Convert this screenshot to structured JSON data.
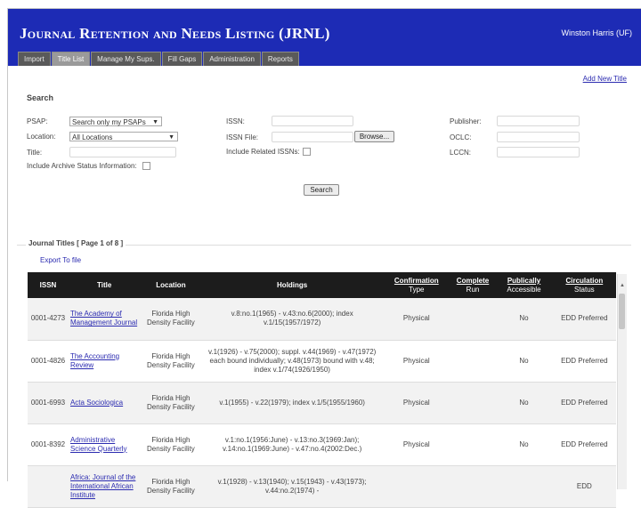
{
  "app": {
    "title": "Journal Retention and Needs Listing (JRNL)",
    "user": "Winston Harris (UF)"
  },
  "tabs": [
    {
      "label": "Import",
      "active": false
    },
    {
      "label": "Title List",
      "active": true
    },
    {
      "label": "Manage My Sups.",
      "active": false
    },
    {
      "label": "Fill Gaps",
      "active": false
    },
    {
      "label": "Administration",
      "active": false
    },
    {
      "label": "Reports",
      "active": false
    }
  ],
  "add_new_title": "Add New Title",
  "search": {
    "heading": "Search",
    "psap_label": "PSAP:",
    "psap_value": "Search only my PSAPs",
    "location_label": "Location:",
    "location_value": "All Locations",
    "title_label": "Title:",
    "archive_label": "Include Archive Status Information:",
    "issn_label": "ISSN:",
    "issn_file_label": "ISSN File:",
    "browse_label": "Browse...",
    "related_label": "Include Related ISSNs:",
    "publisher_label": "Publisher:",
    "oclc_label": "OCLC:",
    "lccn_label": "LCCN:",
    "search_button": "Search"
  },
  "results": {
    "legend": "Journal Titles [ Page 1 of 8 ]",
    "export": "Export To file",
    "columns": {
      "issn": "ISSN",
      "title": "Title",
      "location": "Location",
      "holdings": "Holdings",
      "confirmation": "Confirmation",
      "confirmation_sub": "Type",
      "complete": "Complete",
      "complete_sub": "Run",
      "publicly": "Publically",
      "publicly_sub": "Accessible",
      "circulation": "Circulation",
      "circulation_sub": "Status"
    },
    "rows": [
      {
        "issn": "0001-4273",
        "title": "The Academy of Management Journal",
        "location": "Florida High Density Facility",
        "holdings": "v.8:no.1(1965) - v.43:no.6(2000); index v.1/15(1957/1972)",
        "type": "Physical",
        "complete": "",
        "public": "No",
        "circ": "EDD Preferred"
      },
      {
        "issn": "0001-4826",
        "title": "The Accounting Review",
        "location": "Florida High Density Facility",
        "holdings": "v.1(1926) - v.75(2000); suppl. v.44(1969) - v.47(1972) each bound individually; v.48(1973) bound with v.48; index v.1/74(1926/1950)",
        "type": "Physical",
        "complete": "",
        "public": "No",
        "circ": "EDD Preferred"
      },
      {
        "issn": "0001-6993",
        "title": "Acta Sociologica",
        "location": "Florida High Density Facility",
        "holdings": "v.1(1955) - v.22(1979); index v.1/5(1955/1960)",
        "type": "Physical",
        "complete": "",
        "public": "No",
        "circ": "EDD Preferred"
      },
      {
        "issn": "0001-8392",
        "title": "Administrative Science Quarterly",
        "location": "Florida High Density Facility",
        "holdings": "v.1:no.1(1956:June) - v.13:no.3(1969:Jan); v.14:no.1(1969:June) - v.47:no.4(2002:Dec.)",
        "type": "Physical",
        "complete": "",
        "public": "No",
        "circ": "EDD Preferred"
      },
      {
        "issn": "",
        "title": "Africa: Journal of the International African Institute",
        "location": "Florida High Density Facility",
        "holdings": "v.1(1928) - v.13(1940); v.15(1943) - v.43(1973); v.44:no.2(1974) -",
        "type": "",
        "complete": "",
        "public": "",
        "circ": "EDD"
      }
    ]
  }
}
